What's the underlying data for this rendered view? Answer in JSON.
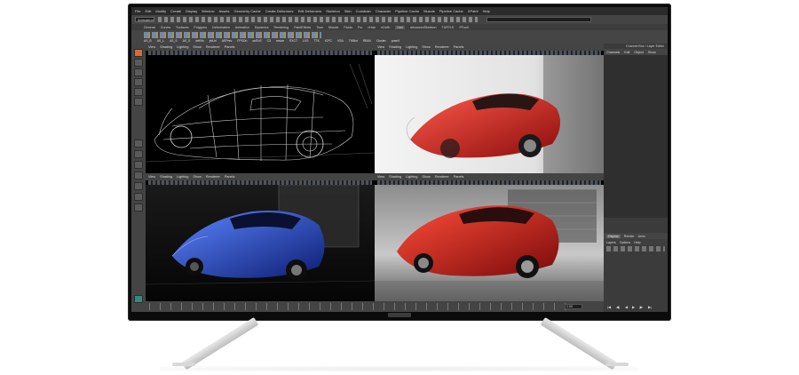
{
  "app": {
    "menu": [
      "File",
      "Edit",
      "Modify",
      "Create",
      "Display",
      "Window",
      "Assets",
      "Geometry Cache",
      "Create Deformers",
      "Edit Deformers",
      "Skeleton",
      "Skin",
      "Constrain",
      "Character",
      "Pipeline Cache",
      "Muscle",
      "Pipeline Cache",
      "XPaint",
      "Help"
    ],
    "mode_menu": "Animation",
    "shelf_tabs": [
      "General",
      "Curves",
      "Surfaces",
      "Polygons",
      "Deformation",
      "Animation",
      "Dynamics",
      "Rendering",
      "PaintEffects",
      "Toon",
      "Muscle",
      "Fluids",
      "Fur",
      "nHair",
      "nCloth",
      "Hair",
      "advancedSkeleton",
      "TURTLE",
      "PFoull"
    ],
    "shelf_active_tab": "Hair",
    "shelf_labels": [
      "AS_B",
      "AS_L",
      "AS_S",
      "AS_S",
      "defVis",
      "jntLbl",
      "AEPrev",
      "FPSOn",
      "selToS",
      "C3",
      "resize",
      "EXCT",
      "LXS",
      "TTK",
      "tCPC",
      "VSA",
      "TKBlot",
      "RBAV",
      "Cluster",
      "poseX"
    ],
    "toolbox": {
      "tools": [
        "select-tool",
        "lasso-tool",
        "paint-select-tool",
        "move-tool",
        "rotate-tool",
        "scale-tool"
      ]
    },
    "channel_box": {
      "title": "Channel Box / Layer Editor",
      "menu": [
        "Channels",
        "Edit",
        "Object",
        "Show"
      ],
      "layer_tabs": [
        "Display",
        "Render",
        "Anim"
      ],
      "layer_active_tab": "Display",
      "layer_menu": [
        "Layers",
        "Options",
        "Help"
      ]
    },
    "viewports": [
      {
        "menu": [
          "View",
          "Shading",
          "Lighting",
          "Show",
          "Renderer",
          "Panels"
        ]
      },
      {
        "menu": [
          "View",
          "Shading",
          "Lighting",
          "Show",
          "Renderer",
          "Panels"
        ]
      },
      {
        "menu": [
          "View",
          "Shading",
          "Lighting",
          "Show",
          "Renderer",
          "Panels"
        ]
      },
      {
        "menu": [
          "View",
          "Shading",
          "Lighting",
          "Show",
          "Renderer",
          "Panels"
        ]
      }
    ],
    "timeline": {
      "current_frame": "1.00"
    },
    "playback_controls": [
      "|◀",
      "◀|",
      "◀",
      "▶",
      "|▶",
      "▶|"
    ]
  },
  "colors": {
    "ui_dark": "#3a3a3a",
    "car_red": "#c81e1e",
    "car_blue": "#2a4fd0",
    "select_orange": "#d86a30"
  }
}
